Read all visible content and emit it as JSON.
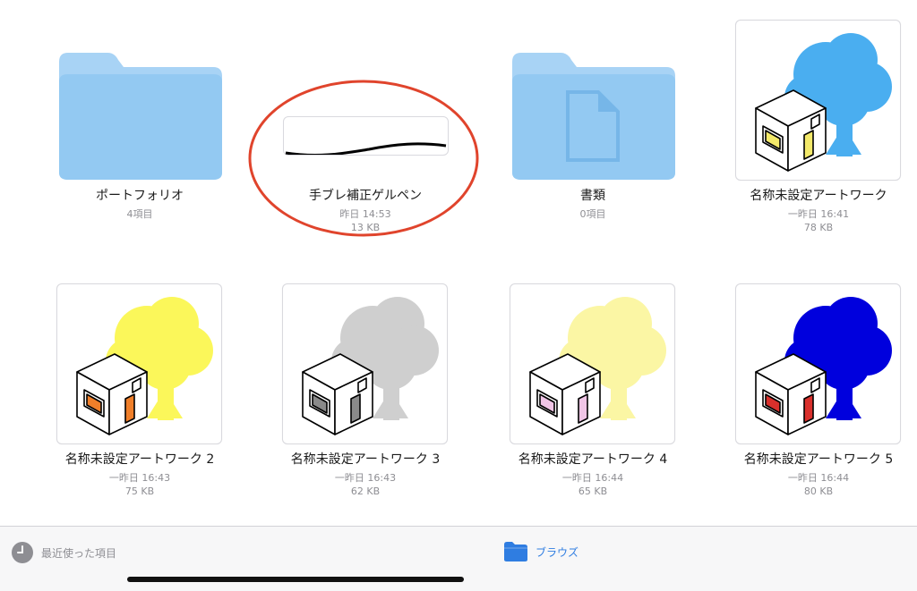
{
  "files": [
    {
      "name": "ポートフォリオ",
      "line1": "4項目",
      "line2": "",
      "kind": "folder"
    },
    {
      "name": "手ブレ補正ゲルペン",
      "line1": "昨日 14:53",
      "line2": "13 KB",
      "kind": "stroke"
    },
    {
      "name": "書類",
      "line1": "0項目",
      "line2": "",
      "kind": "doc-folder"
    },
    {
      "name": "名称未設定アートワーク",
      "line1": "一昨日 16:41",
      "line2": "78 KB",
      "kind": "art",
      "tree_color": "#4aaef0",
      "window_color": "#f3e96a",
      "door_color": "#f3e96a"
    },
    {
      "name": "名称未設定アートワーク 2",
      "line1": "一昨日 16:43",
      "line2": "75 KB",
      "kind": "art",
      "tree_color": "#fbf75a",
      "window_color": "#f07f2a",
      "door_color": "#f07f2a"
    },
    {
      "name": "名称未設定アートワーク 3",
      "line1": "一昨日 16:43",
      "line2": "62 KB",
      "kind": "art",
      "tree_color": "#cfcfcf",
      "window_color": "#8a8a8a",
      "door_color": "#8a8a8a"
    },
    {
      "name": "名称未設定アートワーク 4",
      "line1": "一昨日 16:44",
      "line2": "65 KB",
      "kind": "art",
      "tree_color": "#fbf6a4",
      "window_color": "#f0c5e6",
      "door_color": "#f0c5e6"
    },
    {
      "name": "名称未設定アートワーク 5",
      "line1": "一昨日 16:44",
      "line2": "80 KB",
      "kind": "art",
      "tree_color": "#0000dd",
      "window_color": "#d9302c",
      "door_color": "#d9302c"
    }
  ],
  "tabbar": {
    "recents_label": "最近使った項目",
    "browse_label": "ブラウズ",
    "recents_icon": "clock-icon",
    "browse_icon": "folder-icon",
    "active_color": "#2f7de1",
    "inactive_color": "#8e8e93"
  },
  "annotation": {
    "color": "#e0442c",
    "target": "手ブレ補正ゲルペン"
  }
}
